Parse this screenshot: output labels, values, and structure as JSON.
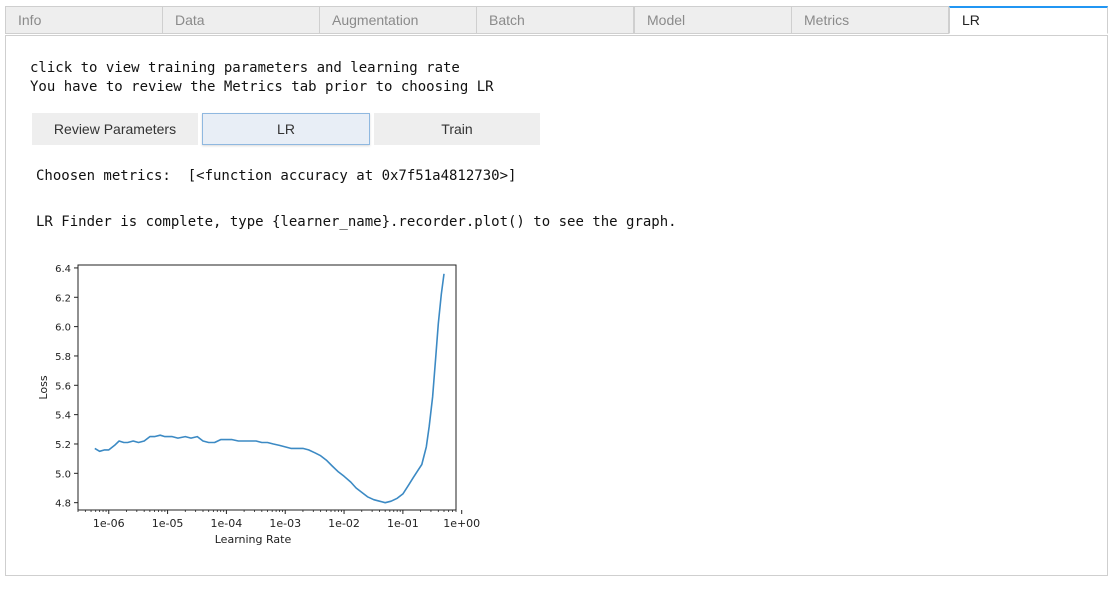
{
  "tabs": [
    {
      "label": "Info",
      "active": false
    },
    {
      "label": "Data",
      "active": false
    },
    {
      "label": "Augmentation",
      "active": false
    },
    {
      "label": "Batch",
      "active": false
    },
    {
      "label": "Model",
      "active": false
    },
    {
      "label": "Metrics",
      "active": false
    },
    {
      "label": "LR",
      "active": true
    }
  ],
  "instructions": {
    "line1": "click to view training parameters and learning rate",
    "line2": "You have to review the Metrics tab prior to choosing LR"
  },
  "buttons": {
    "review": "Review Parameters",
    "lr": "LR",
    "train": "Train",
    "selected": "LR"
  },
  "output": {
    "metrics_line": "Choosen metrics:  [<function accuracy at 0x7f51a4812730>]",
    "finder_line": "LR Finder is complete, type {learner_name}.recorder.plot() to see the graph."
  },
  "colors": {
    "accent": "#2196f3",
    "line": "#3c8ac4"
  },
  "chart_data": {
    "type": "line",
    "xlabel": "Learning Rate",
    "ylabel": "Loss",
    "xscale": "log",
    "xlim": [
      3e-07,
      0.8
    ],
    "ylim": [
      4.75,
      6.42
    ],
    "xticks": [
      1e-06,
      1e-05,
      0.0001,
      0.001,
      0.01,
      0.1,
      1
    ],
    "xticklabels": [
      "1e-06",
      "1e-05",
      "1e-04",
      "1e-03",
      "1e-02",
      "1e-01",
      "1e+00"
    ],
    "yticks": [
      4.8,
      5.0,
      5.2,
      5.4,
      5.6,
      5.8,
      6.0,
      6.2,
      6.4
    ],
    "yticklabels": [
      "4.8",
      "5.0",
      "5.2",
      "5.4",
      "5.6",
      "5.8",
      "6.0",
      "6.2",
      "6.4"
    ],
    "grid": false,
    "series": [
      {
        "x": [
          5.8e-07,
          7e-07,
          8.5e-07,
          1e-06,
          1.25e-06,
          1.5e-06,
          1.8e-06,
          2.1e-06,
          2.6e-06,
          3.2e-06,
          4e-06,
          5e-06,
          6e-06,
          7.5e-06,
          9e-06,
          1.2e-05,
          1.5e-05,
          2e-05,
          2.5e-05,
          3.2e-05,
          4e-05,
          5e-05,
          6.3e-05,
          8e-05,
          0.0001,
          0.000125,
          0.00016,
          0.0002,
          0.00025,
          0.00032,
          0.0004,
          0.0005,
          0.00063,
          0.0008,
          0.001,
          0.00125,
          0.0016,
          0.002,
          0.0025,
          0.0032,
          0.004,
          0.005,
          0.0063,
          0.008,
          0.01,
          0.013,
          0.016,
          0.02,
          0.025,
          0.032,
          0.04,
          0.05,
          0.063,
          0.08,
          0.1,
          0.125,
          0.15,
          0.18,
          0.21,
          0.25,
          0.28,
          0.32,
          0.36,
          0.4,
          0.45,
          0.5
        ],
        "y": [
          5.17,
          5.15,
          5.16,
          5.16,
          5.19,
          5.22,
          5.21,
          5.21,
          5.22,
          5.21,
          5.22,
          5.25,
          5.25,
          5.26,
          5.25,
          5.25,
          5.24,
          5.25,
          5.24,
          5.25,
          5.22,
          5.21,
          5.21,
          5.23,
          5.23,
          5.23,
          5.22,
          5.22,
          5.22,
          5.22,
          5.21,
          5.21,
          5.2,
          5.19,
          5.18,
          5.17,
          5.17,
          5.17,
          5.16,
          5.14,
          5.12,
          5.09,
          5.05,
          5.01,
          4.98,
          4.94,
          4.9,
          4.87,
          4.84,
          4.82,
          4.81,
          4.8,
          4.81,
          4.83,
          4.86,
          4.92,
          4.97,
          5.02,
          5.06,
          5.18,
          5.32,
          5.52,
          5.78,
          6.02,
          6.22,
          6.36
        ]
      }
    ]
  }
}
